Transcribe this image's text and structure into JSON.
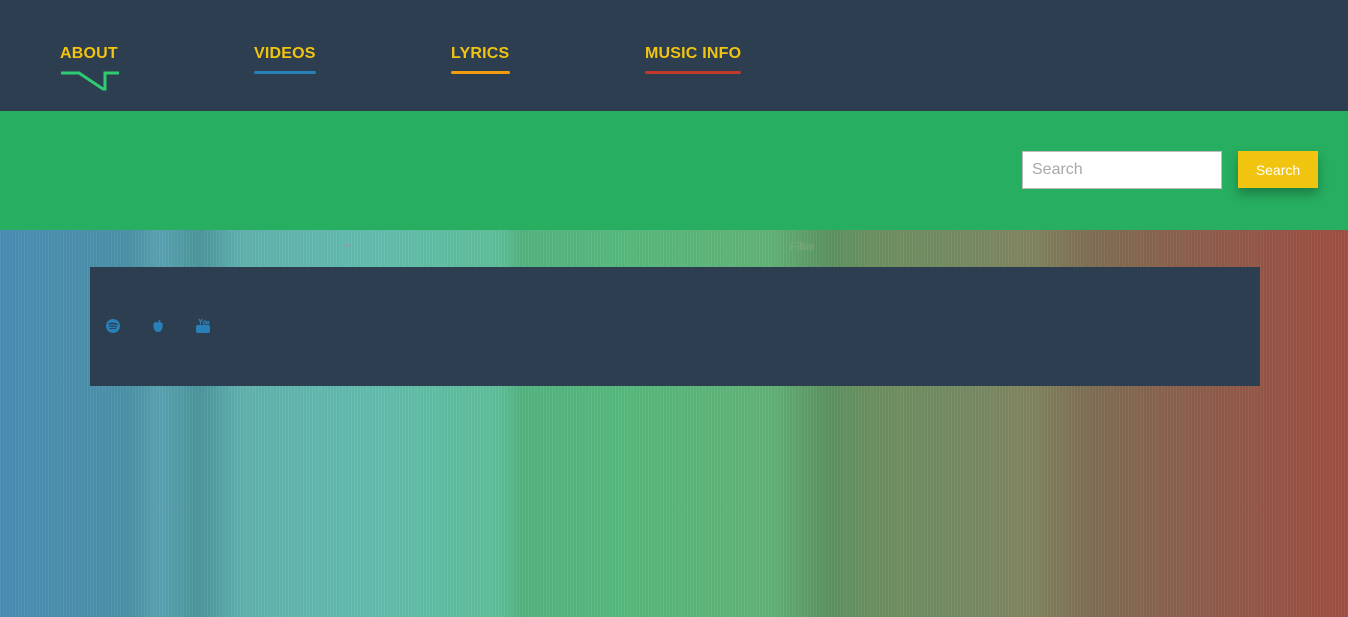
{
  "nav": {
    "items": [
      {
        "label": "ABOUT",
        "color": "#f1c40f",
        "underline_color": "#2ecc71"
      },
      {
        "label": "VIDEOS",
        "color": "#f1c40f",
        "underline_color": "#2980b9"
      },
      {
        "label": "LYRICS",
        "color": "#f1c40f",
        "underline_color": "#f39c12"
      },
      {
        "label": "MUSIC INFO",
        "color": "#f1c40f",
        "underline_color": "#c0392b"
      }
    ],
    "background": "#2d3e50"
  },
  "search": {
    "placeholder": "Search",
    "value": "",
    "button_label": "Search",
    "band_color": "#27ae60",
    "button_color": "#f1c40f"
  },
  "filter": {
    "dropdown_icon": "caret-down-icon",
    "label": "Filter"
  },
  "links": {
    "icons": [
      "spotify-icon",
      "apple-icon",
      "youtube-icon"
    ],
    "icon_color": "#2980b9"
  }
}
